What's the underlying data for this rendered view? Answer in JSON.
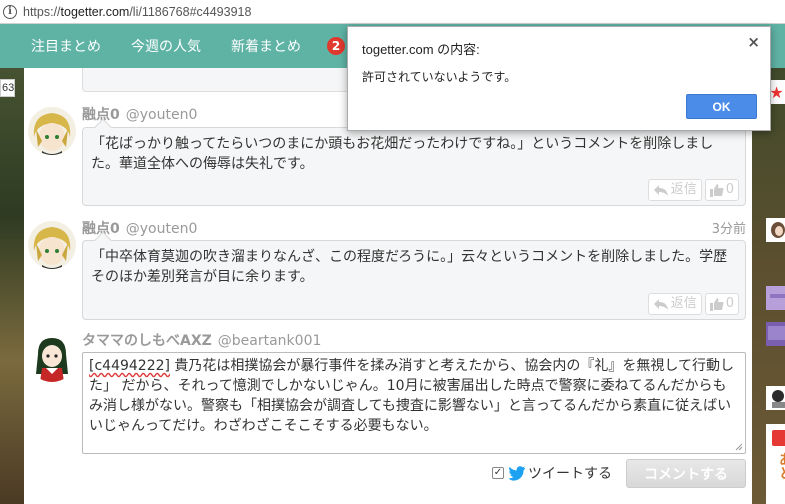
{
  "browser": {
    "url_prefix": "https://",
    "url_domain": "togetter.com",
    "url_path": "/li/1186768#c4493918"
  },
  "nav": {
    "items": [
      "注目まとめ",
      "今週の人気",
      "新着まとめ"
    ],
    "badge": "2"
  },
  "side_number": "63",
  "comments": [
    {
      "name": "融点0",
      "handle": "@youten0",
      "time": "",
      "text": "「花ばっかり触ってたらいつのまにか頭もお花畑だったわけですね。」というコメントを削除しました。華道全体への侮辱は失礼です。",
      "reply_label": "返信",
      "like_count": "0"
    },
    {
      "name": "融点0",
      "handle": "@youten0",
      "time": "3分前",
      "text": "「中卒体育莫迦の吹き溜まりなんざ、この程度だろうに。」云々というコメントを削除しました。学歴そのほか差別発言が目に余ります。",
      "reply_label": "返信",
      "like_count": "0"
    }
  ],
  "composer": {
    "name": "タママのしもべAXZ",
    "handle": "@beartank001",
    "ref": "[c4494222]",
    "text": " 貴乃花は相撲協会が暴行事件を揉み消すと考えたから、協会内の『礼』を無視して行動した」 だから、それって憶測でしかないじゃん。10月に被害届出した時点で警察に委ねてるんだからもみ消し様がない。警察も「相撲協会が調査しても捜査に影響ない」と言ってるんだから素直に従えばいいじゃんってだけ。わざわざこそこそする必要もない。",
    "tweet_label": "ツイートする",
    "tweet_checked": true,
    "submit_label": "コメントする"
  },
  "sidebar_right": {
    "star": "★",
    "text": "あと"
  },
  "dialog": {
    "title": "togetter.com の内容:",
    "message": "許可されていないようです。",
    "ok_label": "OK",
    "close": "×"
  },
  "colors": {
    "nav_bg": "#5fb3a5",
    "badge": "#e0392e",
    "ok_button": "#4a8ce8",
    "twitter": "#1da1f2"
  }
}
